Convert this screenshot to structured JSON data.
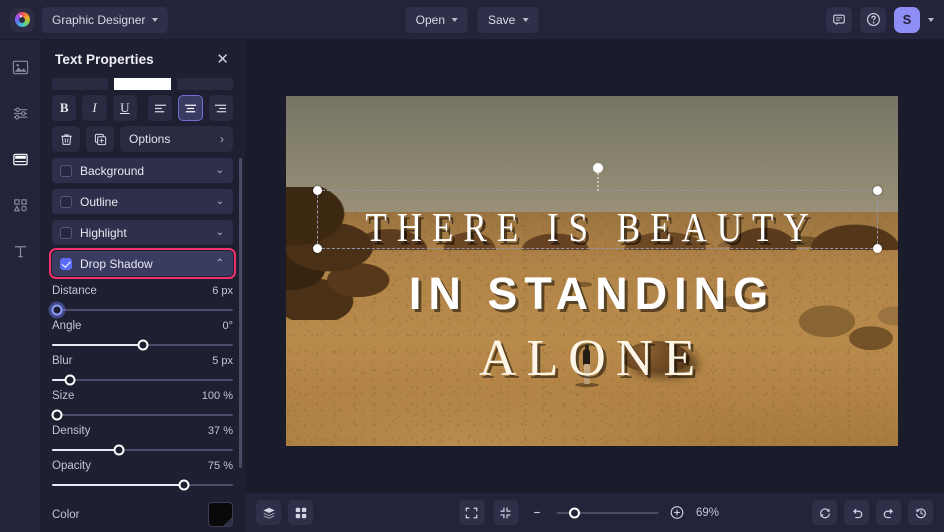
{
  "topbar": {
    "logo_name": "app-logo",
    "project_menu": "Graphic Designer",
    "open_label": "Open",
    "save_label": "Save",
    "comment_icon": "comment-icon",
    "help_icon": "help-icon",
    "avatar_initial": "S"
  },
  "rail": {
    "items": [
      {
        "name": "image-tool",
        "label": "Image"
      },
      {
        "name": "adjust-tool",
        "label": "Adjust"
      },
      {
        "name": "template-tool",
        "label": "Template"
      },
      {
        "name": "shapes-tool",
        "label": "Shapes"
      },
      {
        "name": "text-tool",
        "label": "Text"
      }
    ]
  },
  "panel": {
    "title": "Text Properties",
    "close_label": "✕",
    "format": {
      "bold": "B",
      "italic": "I",
      "underline": "U",
      "align_left": "align-left",
      "align_center": "align-center",
      "align_right": "align-right",
      "selected_align": "align-center"
    },
    "actions": {
      "delete": "delete",
      "duplicate": "duplicate",
      "options_label": "Options",
      "options_arrow": "›"
    },
    "sections": [
      {
        "label": "Background",
        "checked": false,
        "expanded": false,
        "chevron": "⌄",
        "highlighted": false
      },
      {
        "label": "Outline",
        "checked": false,
        "expanded": false,
        "chevron": "⌄",
        "highlighted": false
      },
      {
        "label": "Highlight",
        "checked": false,
        "expanded": false,
        "chevron": "⌄",
        "highlighted": false
      },
      {
        "label": "Drop Shadow",
        "checked": true,
        "expanded": true,
        "chevron": "⌃",
        "highlighted": true
      }
    ],
    "sliders": [
      {
        "name": "Distance",
        "value": "6 px",
        "pct": 3,
        "active": true
      },
      {
        "name": "Angle",
        "value": "0°",
        "pct": 50,
        "active": false
      },
      {
        "name": "Blur",
        "value": "5 px",
        "pct": 10,
        "active": false
      },
      {
        "name": "Size",
        "value": "100 %",
        "pct": 3,
        "active": false
      },
      {
        "name": "Density",
        "value": "37 %",
        "pct": 37,
        "active": false
      },
      {
        "name": "Opacity",
        "value": "75 %",
        "pct": 73,
        "active": false
      }
    ],
    "color": {
      "label": "Color",
      "value": "#0a0a0a"
    }
  },
  "canvas": {
    "text_lines": [
      "THERE IS BEAUTY",
      "IN STANDING",
      "ALONE"
    ]
  },
  "bottombar": {
    "layers_icon": "layers-icon",
    "grid_icon": "grid-icon",
    "fit_icon": "fit-to-screen-icon",
    "shrink_icon": "shrink-to-fit-icon",
    "zoom_out": "⊖",
    "zoom_in": "⊕",
    "zoom_level": "69%",
    "reset_icon": "reset-icon",
    "undo_icon": "undo-icon",
    "redo_icon": "redo-icon",
    "history_icon": "history-icon"
  },
  "colors": {
    "accent": "#5b6cf5",
    "highlight": "#f2306b",
    "panel_bg": "#1e1f30",
    "bar_bg": "#23243a",
    "avatar_bg": "#8e8ef5"
  }
}
